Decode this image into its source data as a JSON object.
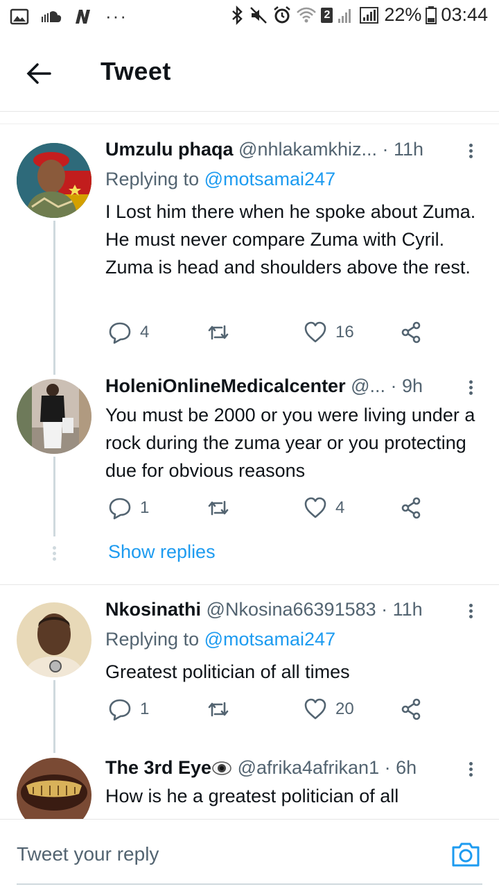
{
  "status_bar": {
    "battery": "22%",
    "time": "03:44",
    "sim_badge": "2"
  },
  "header": {
    "title": "Tweet"
  },
  "tweets": [
    {
      "name": "Umzulu phaqa",
      "handle": "@nhlakamkhiz...",
      "time": "· 11h",
      "replying_prefix": "Replying to ",
      "replying_to": "@motsamai247",
      "text": "I Lost him there when he spoke about Zuma. He must never compare Zuma with Cyril. Zuma is head and shoulders above the rest.",
      "replies": "4",
      "retweets": "",
      "likes": "16"
    },
    {
      "name": "HoleniOnlineMedicalcenter",
      "handle": "@...",
      "time": "· 9h",
      "text": "You must be 2000 or you were living under a rock during the zuma year or you protecting due for obvious reasons",
      "replies": "1",
      "retweets": "",
      "likes": "4"
    },
    {
      "name": "Nkosinathi",
      "handle": "@Nkosina66391583",
      "time": "· 11h",
      "replying_prefix": "Replying to ",
      "replying_to": "@motsamai247",
      "text": "Greatest politician of all times",
      "replies": "1",
      "retweets": "",
      "likes": "20"
    },
    {
      "name": "The 3rd Eye",
      "handle": "@afrika4afrikan1",
      "time": "· 6h",
      "text": "How is he a greatest politician of all"
    }
  ],
  "show_replies": "Show replies",
  "composer": {
    "placeholder": "Tweet your reply"
  },
  "colors": {
    "accent": "#1d9bf0",
    "muted": "#536471",
    "thread_line": "#cfd9de"
  }
}
